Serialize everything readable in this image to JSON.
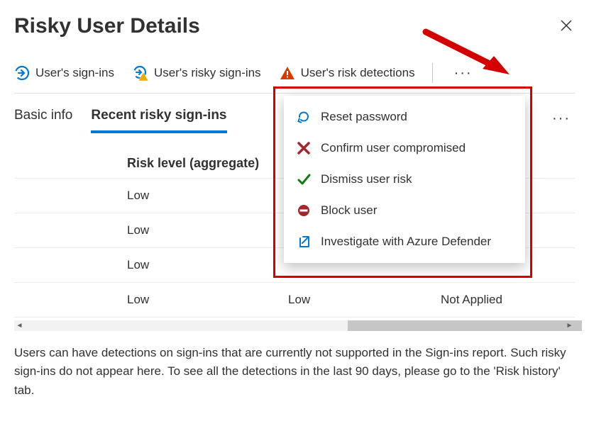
{
  "header": {
    "title": "Risky User Details"
  },
  "toolbar": {
    "signins": "User's sign-ins",
    "risky_signins": "User's risky sign-ins",
    "risk_detections": "User's risk detections"
  },
  "tabs": {
    "basic": "Basic info",
    "recent": "Recent risky sign-ins"
  },
  "table": {
    "header": {
      "risk_level_agg": "Risk level (aggregate)"
    },
    "rows": [
      {
        "c2": "Low",
        "c3": "",
        "c4": ""
      },
      {
        "c2": "Low",
        "c3": "",
        "c4": ""
      },
      {
        "c2": "Low",
        "c3": "",
        "c4": ""
      },
      {
        "c2": "Low",
        "c3": "Low",
        "c4": "Not Applied"
      }
    ]
  },
  "context_menu": {
    "reset": "Reset password",
    "confirm": "Confirm user compromised",
    "dismiss": "Dismiss user risk",
    "block": "Block user",
    "investigate": "Investigate with Azure Defender"
  },
  "note": "Users can have detections on sign-ins that are currently not supported in the Sign-ins report. Such risky sign-ins do not appear here. To see all the detections in the last 90 days, please go to the 'Risk history' tab."
}
